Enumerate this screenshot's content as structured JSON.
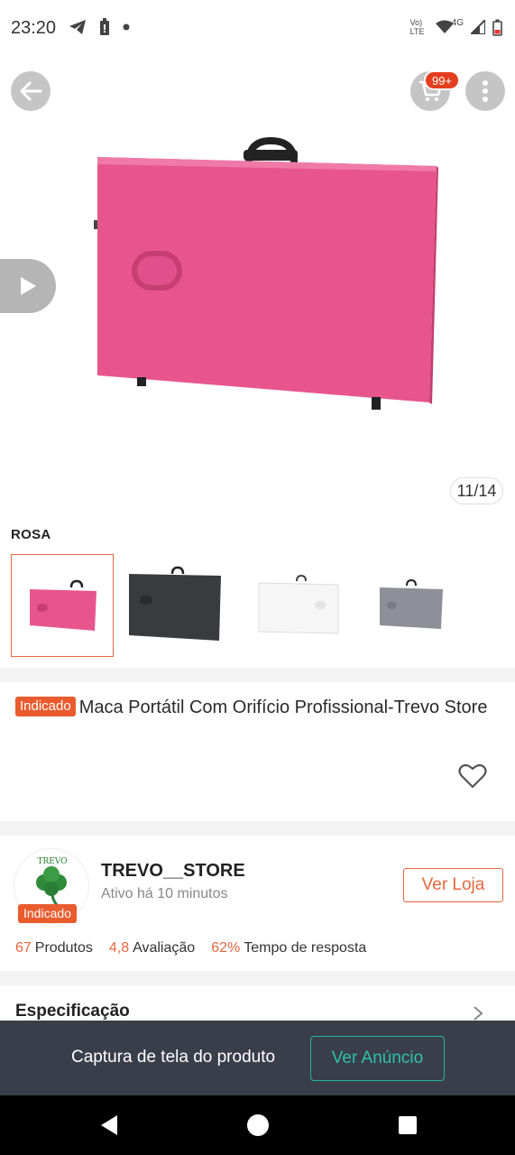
{
  "status_bar": {
    "time": "23:20",
    "icons_left": [
      "telegram-icon",
      "battery-saver-icon",
      "dot-icon"
    ],
    "icons_right": [
      "volte-icon",
      "wifi-icon",
      "signal-icon",
      "battery-icon"
    ],
    "volte_label": "Vo) LTE",
    "network_label": "4G"
  },
  "top_actions": {
    "back_icon": "back-arrow-icon",
    "cart_icon": "cart-icon",
    "cart_badge": "99+",
    "more_icon": "more-vertical-icon"
  },
  "gallery": {
    "counter": "11/14",
    "product_color": "#e8558d",
    "play_icon": "play-icon"
  },
  "variants": {
    "label": "ROSA",
    "items": [
      {
        "name": "rosa",
        "color": "#e8558d",
        "selected": true
      },
      {
        "name": "preto",
        "color": "#3a3b3f",
        "selected": false
      },
      {
        "name": "branco",
        "color": "#f6f6f6",
        "selected": false
      },
      {
        "name": "cinza",
        "color": "#8e8f98",
        "selected": false
      }
    ]
  },
  "product": {
    "badge": "Indicado",
    "title": "Maca Portátil Com Orifício Profissional-Trevo Store",
    "favorite_icon": "heart-outline-icon"
  },
  "store": {
    "logo_text": "TREVO",
    "badge": "Indicado",
    "name": "TREVO__STORE",
    "active": "Ativo há 10 minutos",
    "visit_button": "Ver Loja",
    "stats": [
      {
        "value": "67",
        "label": "Produtos"
      },
      {
        "value": "4,8",
        "label": "Avaliação"
      },
      {
        "value": "62%",
        "label": "Tempo de resposta"
      }
    ]
  },
  "specification": {
    "label": "Especificação"
  },
  "bottom_bar": {
    "text": "Captura de tela do produto",
    "button": "Ver Anúncio"
  },
  "colors": {
    "accent": "#e5673e",
    "badge": "#ea5b2e",
    "teal": "#2cc0ae",
    "bottom_bar": "#3a3e4a"
  }
}
